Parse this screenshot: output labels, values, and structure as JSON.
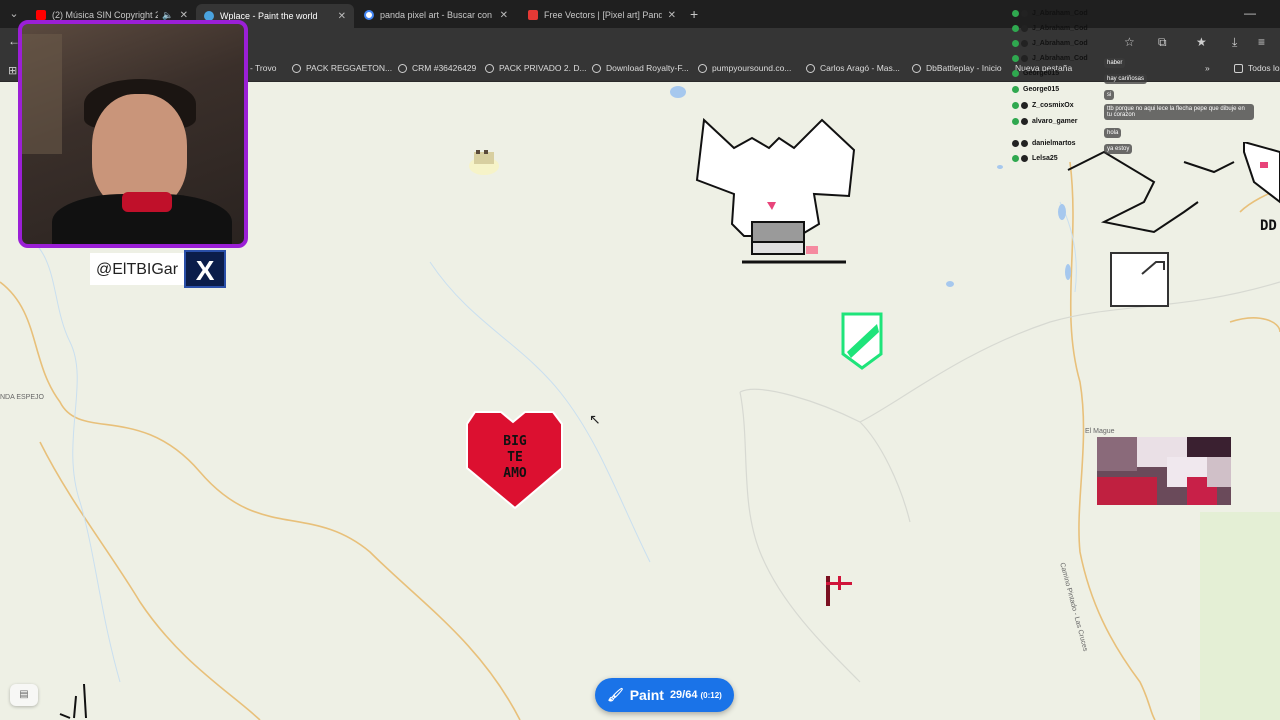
{
  "tabs": [
    {
      "title": "(2) Música SIN Copyright 2·",
      "color": "#ff0000"
    },
    {
      "title": "Wplace - Paint the world",
      "color": "#4aa3df"
    },
    {
      "title": "panda pixel art - Buscar con Go",
      "color": "#ffffff"
    },
    {
      "title": "Free Vectors | [Pixel art] Panda",
      "color": "#e53935"
    }
  ],
  "bookmarks": [
    "- Trovo",
    "PACK REGGAETON...",
    "CRM #36426429",
    "PACK PRIVADO 2. D...",
    "Download Royalty-F...",
    "pumpyoursound.co...",
    "Carlos Aragó - Mas...",
    "DbBattleplay - Inicio",
    "Nueva pestaña",
    "Todos lo"
  ],
  "webcam": {
    "handle": "@ElTBIGar",
    "social_icon": "X"
  },
  "chat": [
    {
      "name": "J_Abraham_Cod",
      "msg": ""
    },
    {
      "name": "J_Abraham_Cod",
      "msg": ""
    },
    {
      "name": "J_Abraham_Cod",
      "msg": ""
    },
    {
      "name": "J_Abraham_Cod",
      "msg": ""
    },
    {
      "name": "George015",
      "msg": "haber"
    },
    {
      "name": "George015",
      "msg": "hay cariñosas"
    },
    {
      "name": "Z_cosmixOx",
      "msg": "si"
    },
    {
      "name": "alvaro_gamer",
      "msg": "ttb porque no aqui lece la flecha pepe que dibuje en tu corazon"
    },
    {
      "name": "danielmartos",
      "msg": "hola"
    },
    {
      "name": "Lelsa25",
      "msg": "ya estoy"
    }
  ],
  "map": {
    "labels": [
      "NDA ESPEJO",
      "El Mague",
      "Camino Pintado - Las Cruces"
    ]
  },
  "heart_art": {
    "line1": "BIG",
    "line2": "TE",
    "line3": "AMO"
  },
  "paint_button": {
    "label": "Paint",
    "count": "29/64",
    "timer": "(0:12)"
  }
}
